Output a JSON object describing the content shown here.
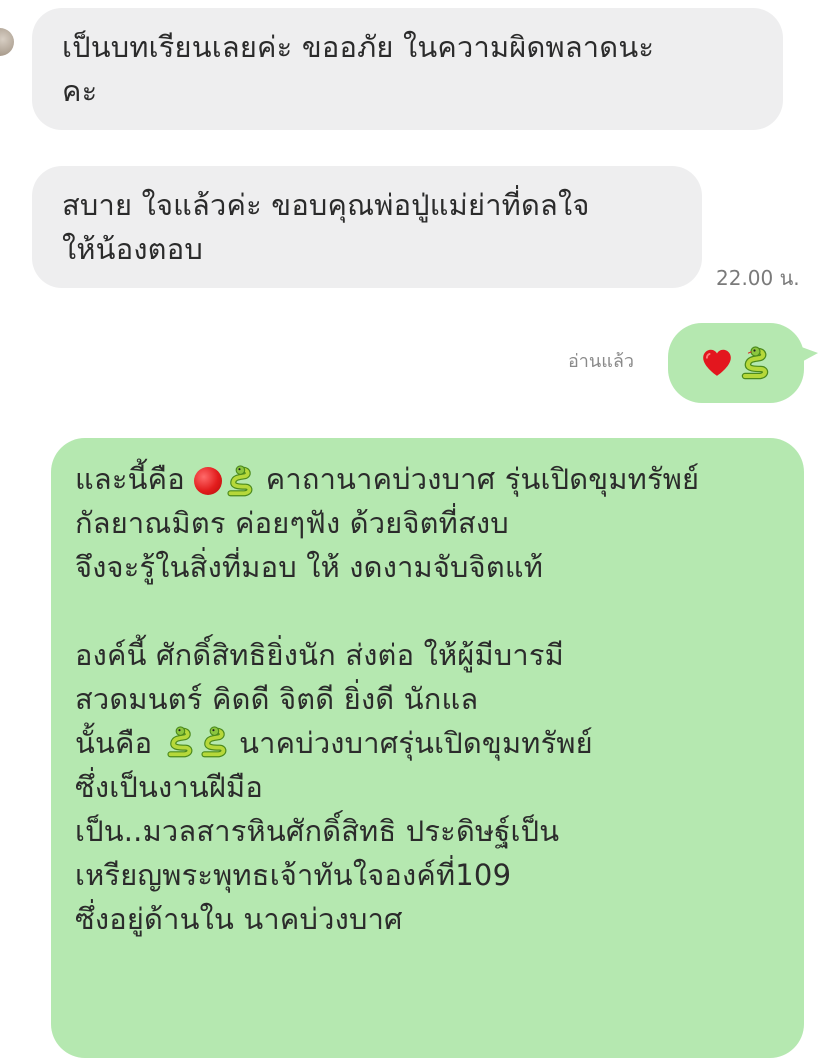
{
  "messages": {
    "incoming_1": {
      "line1": "เป็นบทเรียนเลยค่ะ ขออภัย ในความผิดพลาดนะ",
      "line2": "คะ"
    },
    "incoming_2": {
      "line1": "สบาย ใจแล้วค่ะ ขอบคุณพ่อปู่แม่ย่าที่ดลใจ",
      "line2": "ให้น้องตอบ",
      "time": "22.00 น."
    },
    "outgoing_1": {
      "read_status": "อ่านแล้ว",
      "emojis": [
        "heart-icon",
        "snake-icon"
      ]
    },
    "outgoing_2": {
      "l1_pre": "และนี้คือ",
      "l1_post": " คาถานาคบ่วงบาศ รุ่นเปิดขุมทรัพย์",
      "l2": "กัลยาณมิตร ค่อยๆฟัง ด้วยจิตที่สงบ",
      "l3": "จึงจะรู้ในสิ่งที่มอบ ให้ งดงามจับจิตแท้",
      "l4": "องค์นี้ ศักดิ์สิทธิยิ่งนัก ส่งต่อ ให้ผู้มีบารมี",
      "l5": "สวดมนตร์ คิดดี จิตดี ยิ่งดี นักแล",
      "l6_pre": "นั้นคือ ",
      "l6_post": "นาคบ่วงบาศรุ่นเปิดขุมทรัพย์",
      "l7": "ซึ่งเป็นงานฝีมือ",
      "l8": "เป็น..มวลสารหินศักดิ์สิทธิ ประดิษฐ์เป็น",
      "l9": "เหรียญพระพุทธเจ้าทันใจองค์ที่109",
      "l10": "ซึ่งอยู่ด้านใน นาคบ่วงบาศ"
    }
  },
  "colors": {
    "incoming_bubble": "#eeeeef",
    "outgoing_bubble": "#b5e8b0",
    "text": "#2b2b2b",
    "meta_text": "#7a7a7a"
  }
}
